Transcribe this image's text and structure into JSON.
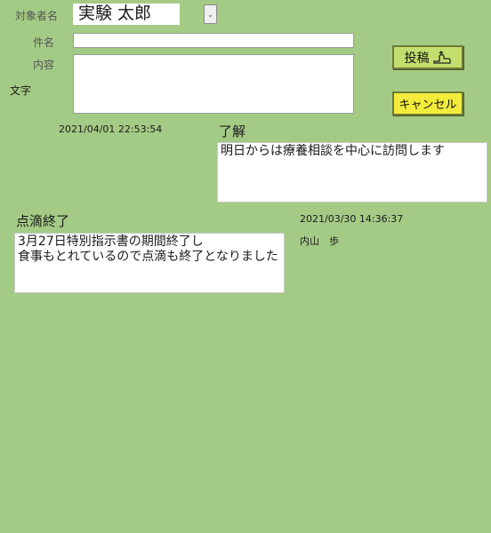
{
  "form": {
    "subject_label": "対象者名",
    "subject_value": "実験 太郎",
    "title_label": "件名",
    "title_value": "",
    "content_label": "内容",
    "content_value": "",
    "text_label": "文字",
    "post_button": "投稿",
    "cancel_button": "キャンセル"
  },
  "posts": [
    {
      "timestamp": "2021/04/01 22:53:54",
      "title": "了解",
      "body": "明日からは療養相談を中心に訪問します",
      "author": ""
    },
    {
      "timestamp": "2021/03/30 14:36:37",
      "title": "点滴終了",
      "body": "3月27日特別指示書の期間終了し\n食事もとれているので点滴も終了となりました",
      "author": "内山　歩"
    }
  ],
  "icons": {
    "dropdown": "chevron-down-icon",
    "post": "send-hand-icon"
  }
}
